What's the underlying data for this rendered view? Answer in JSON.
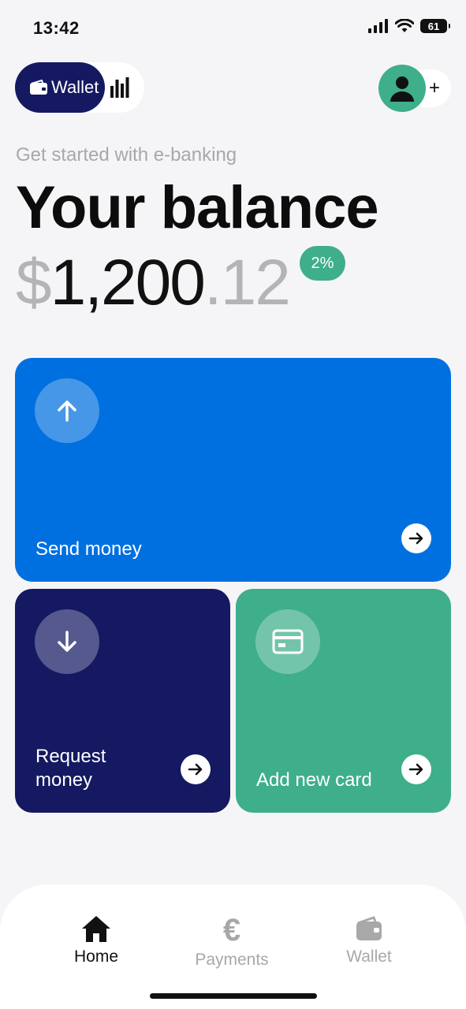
{
  "status_bar": {
    "time": "13:42",
    "battery": "61"
  },
  "toggle": {
    "active_label": "Wallet",
    "active_icon": "wallet-icon",
    "inactive_icon": "bar-chart-icon"
  },
  "profile": {
    "avatar_icon": "user-icon",
    "add_icon": "plus-icon",
    "add_label": "+"
  },
  "header": {
    "subtitle": "Get started with e-banking",
    "title": "Your balance"
  },
  "balance": {
    "currency": "$",
    "whole": "1,200",
    "decimal_separator": ".",
    "cents": "12",
    "change_badge": "2%"
  },
  "cards": [
    {
      "label": "Send money",
      "icon": "arrow-up-icon",
      "color": "#0070e0"
    },
    {
      "label": "Request money",
      "icon": "arrow-down-icon",
      "color": "#141961"
    },
    {
      "label": "Add new card",
      "icon": "credit-card-icon",
      "color": "#3fae8b"
    }
  ],
  "bottom_nav": [
    {
      "label": "Home",
      "icon": "home-icon",
      "active": true
    },
    {
      "label": "Payments",
      "icon": "euro-icon",
      "active": false
    },
    {
      "label": "Wallet",
      "icon": "wallet-icon",
      "active": false
    }
  ],
  "colors": {
    "background": "#f5f5f7",
    "accent_navy": "#141961",
    "accent_blue": "#0070e0",
    "accent_green": "#3fae8b",
    "muted_text": "#a8a8ab"
  }
}
